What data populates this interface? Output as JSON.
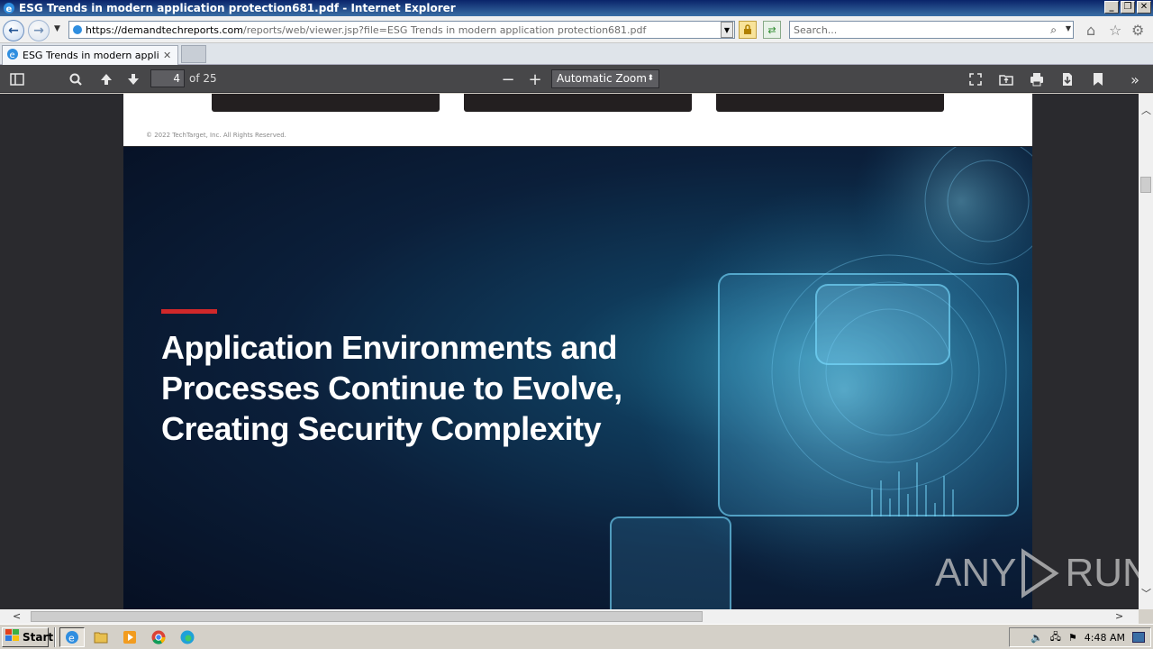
{
  "window": {
    "title": "ESG Trends in modern application protection681.pdf - Internet Explorer",
    "minimize_label": "_",
    "maximize_label": "❐",
    "close_label": "✕"
  },
  "address_bar": {
    "url_domain": "https://demandtechreports.com",
    "url_path": "/reports/web/viewer.jsp?file=ESG Trends in modern application protection681.pdf",
    "search_placeholder": "Search..."
  },
  "tabs": [
    {
      "label": "ESG Trends in modern applic...",
      "close": "✕"
    }
  ],
  "pdf_toolbar": {
    "current_page": "4",
    "page_count_label": "of 25",
    "zoom_label": "Automatic Zoom"
  },
  "document": {
    "copyright": "© 2022 TechTarget, Inc. All Rights Reserved.",
    "headline_lines": [
      "Application Environments and",
      "Processes Continue to Evolve,",
      "Creating Security Complexity"
    ]
  },
  "watermark": {
    "left": "ANY",
    "right": "RUN"
  },
  "taskbar": {
    "start_label": "Start",
    "clock": "4:48 AM"
  },
  "colors": {
    "title_bar": "#0a246a",
    "pdf_toolbar": "#474749",
    "viewer_bg": "#2a2a2e",
    "accent_red": "#d0282a"
  }
}
